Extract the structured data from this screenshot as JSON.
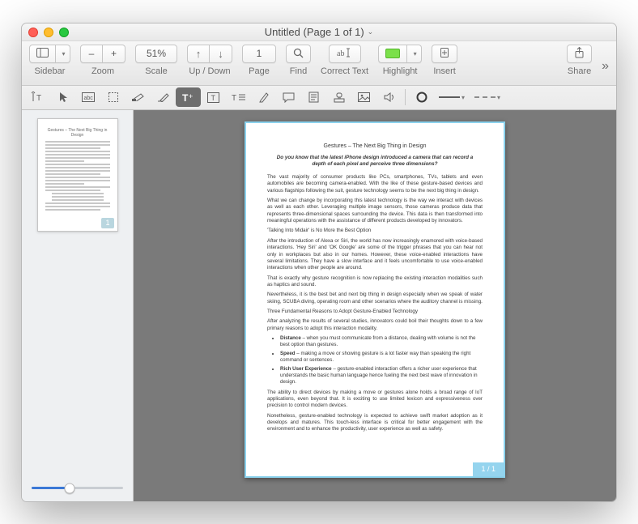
{
  "window": {
    "title": "Untitled (Page 1 of 1)"
  },
  "toolbar": {
    "sidebar": {
      "label": "Sidebar"
    },
    "zoom": {
      "label": "Zoom",
      "minus": "–",
      "plus": "+"
    },
    "scale": {
      "label": "Scale",
      "value": "51%"
    },
    "updown": {
      "label": "Up / Down"
    },
    "page": {
      "label": "Page",
      "value": "1"
    },
    "find": {
      "label": "Find"
    },
    "correct": {
      "label": "Correct Text"
    },
    "highlight": {
      "label": "Highlight"
    },
    "insert": {
      "label": "Insert"
    },
    "share": {
      "label": "Share"
    }
  },
  "subtoolbar": {
    "items": [
      "edit-text",
      "select",
      "ocr",
      "crop",
      "redact",
      "erase",
      "add-text",
      "text-box",
      "text-style",
      "highlighter",
      "comment",
      "note",
      "stamp",
      "image",
      "sound",
      "shape"
    ]
  },
  "thumbnail": {
    "page_badge": "1"
  },
  "document": {
    "title": "Gestures – The Next Big Thing in Design",
    "subtitle": "Do you know that the latest iPhone design introduced a camera that can record a depth of each pixel and perceive three dimensions?",
    "p1": "The vast majority of consumer products like PCs, smartphones, TVs, tablets and even automobiles are becoming camera-enabled. With the like of these gesture-based devices and various flagships following the suit, gesture technology seems to be the next big thing in design.",
    "p2": "What we can change by incorporating this latest technology is the way we interact with devices as well as each other. Leveraging multiple image sensors, those cameras produce data that represents three-dimensional spaces surrounding the device. This data is then transformed into meaningful operations with the assistance of different products developed by innovators.",
    "h1": "'Talking Into Midair' is No More the Best Option",
    "p3": "After the introduction of Alexa or Siri, the world has now increasingly enamored with voice-based interactions. 'Hey Siri' and 'OK Google' are some of the trigger phrases that you can hear not only in workplaces but also in our homes. However, these voice-enabled interactions have several limitations. They have a slow interface and it feels uncomfortable to use voice-enabled interactions when other people are around.",
    "p4": "That is exactly why gesture recognition is now replacing the existing interaction modalities such as haptics and sound.",
    "p5": "Nevertheless, it is the best bet and next big thing in design especially when we speak of water skiing, SCUBA diving, operating room and other scenarios where the auditory channel is missing.",
    "h2": "Three Fundamental Reasons to Adopt Gesture-Enabled Technology",
    "p6": "After analyzing the results of several studies, innovators could boil their thoughts down to a few primary reasons to adopt this interaction modality.",
    "b1_label": "Distance",
    "b1_text": " – when you must communicate from a distance, dealing with volume is not the best option than gestures.",
    "b2_label": "Speed",
    "b2_text": " – making a move or showing gesture is a lot faster way than speaking the right command or sentences.",
    "b3_label": "Rich User Experience",
    "b3_text": " – gesture-enabled interaction offers a richer user experience that understands the basic human language hence fueling the next best wave of innovation in design.",
    "p7": "The ability to direct devices by making a move or gestures alone holds a broad range of IoT applications, even beyond that. It is exciting to use limited lexicon and expressiveness over precision to control modern devices.",
    "p8": "Nonetheless, gesture-enabled technology is expected to achieve swift market adoption as it develops and matures. This touch-less interface is critical for better engagement with the environment and to enhance the productivity, user experience as well as safety.",
    "page_indicator": "1 / 1"
  }
}
